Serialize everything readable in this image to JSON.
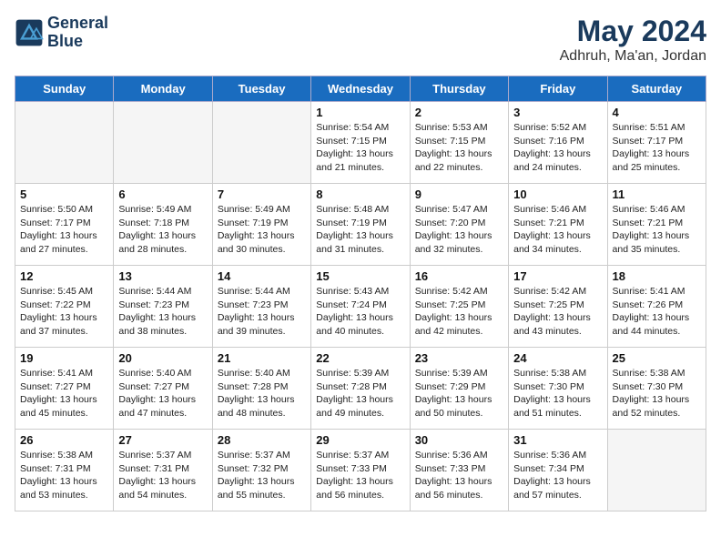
{
  "header": {
    "logo_line1": "General",
    "logo_line2": "Blue",
    "month": "May 2024",
    "location": "Adhruh, Ma'an, Jordan"
  },
  "days_of_week": [
    "Sunday",
    "Monday",
    "Tuesday",
    "Wednesday",
    "Thursday",
    "Friday",
    "Saturday"
  ],
  "weeks": [
    [
      {
        "day": "",
        "info": ""
      },
      {
        "day": "",
        "info": ""
      },
      {
        "day": "",
        "info": ""
      },
      {
        "day": "1",
        "info": "Sunrise: 5:54 AM\nSunset: 7:15 PM\nDaylight: 13 hours\nand 21 minutes."
      },
      {
        "day": "2",
        "info": "Sunrise: 5:53 AM\nSunset: 7:15 PM\nDaylight: 13 hours\nand 22 minutes."
      },
      {
        "day": "3",
        "info": "Sunrise: 5:52 AM\nSunset: 7:16 PM\nDaylight: 13 hours\nand 24 minutes."
      },
      {
        "day": "4",
        "info": "Sunrise: 5:51 AM\nSunset: 7:17 PM\nDaylight: 13 hours\nand 25 minutes."
      }
    ],
    [
      {
        "day": "5",
        "info": "Sunrise: 5:50 AM\nSunset: 7:17 PM\nDaylight: 13 hours\nand 27 minutes."
      },
      {
        "day": "6",
        "info": "Sunrise: 5:49 AM\nSunset: 7:18 PM\nDaylight: 13 hours\nand 28 minutes."
      },
      {
        "day": "7",
        "info": "Sunrise: 5:49 AM\nSunset: 7:19 PM\nDaylight: 13 hours\nand 30 minutes."
      },
      {
        "day": "8",
        "info": "Sunrise: 5:48 AM\nSunset: 7:19 PM\nDaylight: 13 hours\nand 31 minutes."
      },
      {
        "day": "9",
        "info": "Sunrise: 5:47 AM\nSunset: 7:20 PM\nDaylight: 13 hours\nand 32 minutes."
      },
      {
        "day": "10",
        "info": "Sunrise: 5:46 AM\nSunset: 7:21 PM\nDaylight: 13 hours\nand 34 minutes."
      },
      {
        "day": "11",
        "info": "Sunrise: 5:46 AM\nSunset: 7:21 PM\nDaylight: 13 hours\nand 35 minutes."
      }
    ],
    [
      {
        "day": "12",
        "info": "Sunrise: 5:45 AM\nSunset: 7:22 PM\nDaylight: 13 hours\nand 37 minutes."
      },
      {
        "day": "13",
        "info": "Sunrise: 5:44 AM\nSunset: 7:23 PM\nDaylight: 13 hours\nand 38 minutes."
      },
      {
        "day": "14",
        "info": "Sunrise: 5:44 AM\nSunset: 7:23 PM\nDaylight: 13 hours\nand 39 minutes."
      },
      {
        "day": "15",
        "info": "Sunrise: 5:43 AM\nSunset: 7:24 PM\nDaylight: 13 hours\nand 40 minutes."
      },
      {
        "day": "16",
        "info": "Sunrise: 5:42 AM\nSunset: 7:25 PM\nDaylight: 13 hours\nand 42 minutes."
      },
      {
        "day": "17",
        "info": "Sunrise: 5:42 AM\nSunset: 7:25 PM\nDaylight: 13 hours\nand 43 minutes."
      },
      {
        "day": "18",
        "info": "Sunrise: 5:41 AM\nSunset: 7:26 PM\nDaylight: 13 hours\nand 44 minutes."
      }
    ],
    [
      {
        "day": "19",
        "info": "Sunrise: 5:41 AM\nSunset: 7:27 PM\nDaylight: 13 hours\nand 45 minutes."
      },
      {
        "day": "20",
        "info": "Sunrise: 5:40 AM\nSunset: 7:27 PM\nDaylight: 13 hours\nand 47 minutes."
      },
      {
        "day": "21",
        "info": "Sunrise: 5:40 AM\nSunset: 7:28 PM\nDaylight: 13 hours\nand 48 minutes."
      },
      {
        "day": "22",
        "info": "Sunrise: 5:39 AM\nSunset: 7:28 PM\nDaylight: 13 hours\nand 49 minutes."
      },
      {
        "day": "23",
        "info": "Sunrise: 5:39 AM\nSunset: 7:29 PM\nDaylight: 13 hours\nand 50 minutes."
      },
      {
        "day": "24",
        "info": "Sunrise: 5:38 AM\nSunset: 7:30 PM\nDaylight: 13 hours\nand 51 minutes."
      },
      {
        "day": "25",
        "info": "Sunrise: 5:38 AM\nSunset: 7:30 PM\nDaylight: 13 hours\nand 52 minutes."
      }
    ],
    [
      {
        "day": "26",
        "info": "Sunrise: 5:38 AM\nSunset: 7:31 PM\nDaylight: 13 hours\nand 53 minutes."
      },
      {
        "day": "27",
        "info": "Sunrise: 5:37 AM\nSunset: 7:31 PM\nDaylight: 13 hours\nand 54 minutes."
      },
      {
        "day": "28",
        "info": "Sunrise: 5:37 AM\nSunset: 7:32 PM\nDaylight: 13 hours\nand 55 minutes."
      },
      {
        "day": "29",
        "info": "Sunrise: 5:37 AM\nSunset: 7:33 PM\nDaylight: 13 hours\nand 56 minutes."
      },
      {
        "day": "30",
        "info": "Sunrise: 5:36 AM\nSunset: 7:33 PM\nDaylight: 13 hours\nand 56 minutes."
      },
      {
        "day": "31",
        "info": "Sunrise: 5:36 AM\nSunset: 7:34 PM\nDaylight: 13 hours\nand 57 minutes."
      },
      {
        "day": "",
        "info": ""
      }
    ]
  ]
}
